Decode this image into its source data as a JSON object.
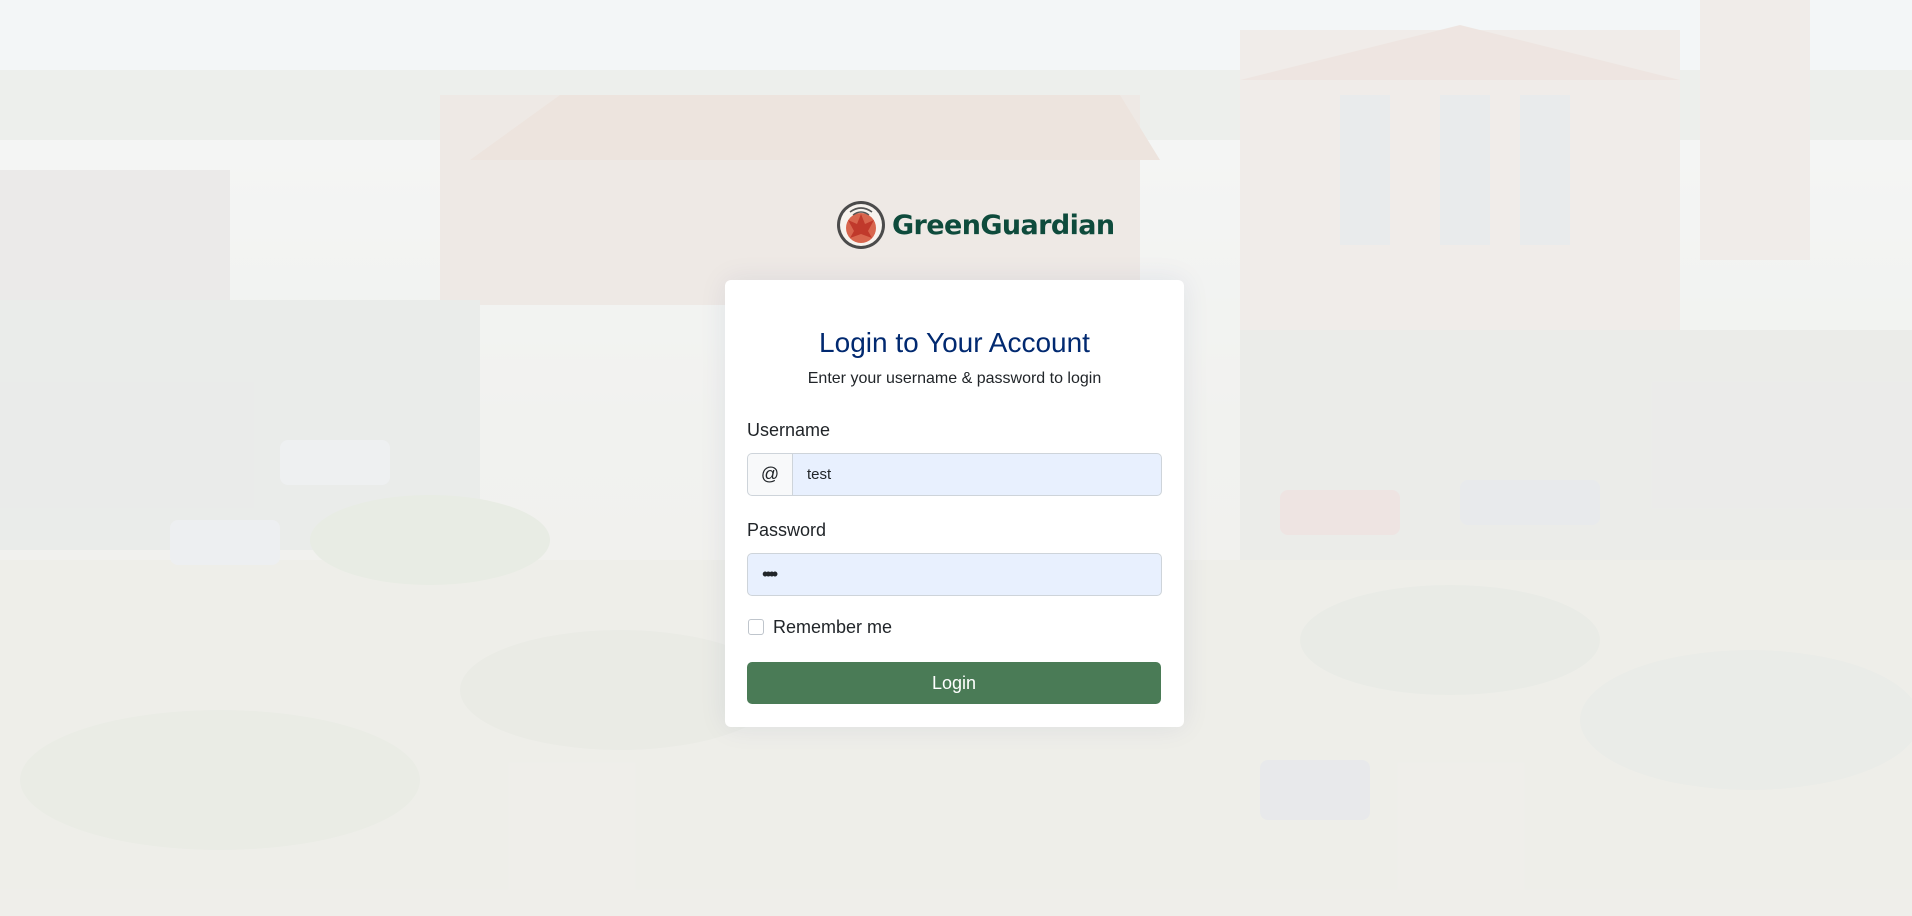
{
  "brand": {
    "name": "GreenGuardian"
  },
  "login": {
    "title": "Login to Your Account",
    "subtitle": "Enter your username & password to login",
    "username_label": "Username",
    "username_prefix": "@",
    "username_value": "test",
    "password_label": "Password",
    "password_value": "test",
    "remember_label": "Remember me",
    "remember_checked": false,
    "submit_label": "Login"
  },
  "colors": {
    "brand_text": "#0e4b3c",
    "title": "#012970",
    "button": "#4a7b56",
    "autofill": "#e8f0fe"
  }
}
